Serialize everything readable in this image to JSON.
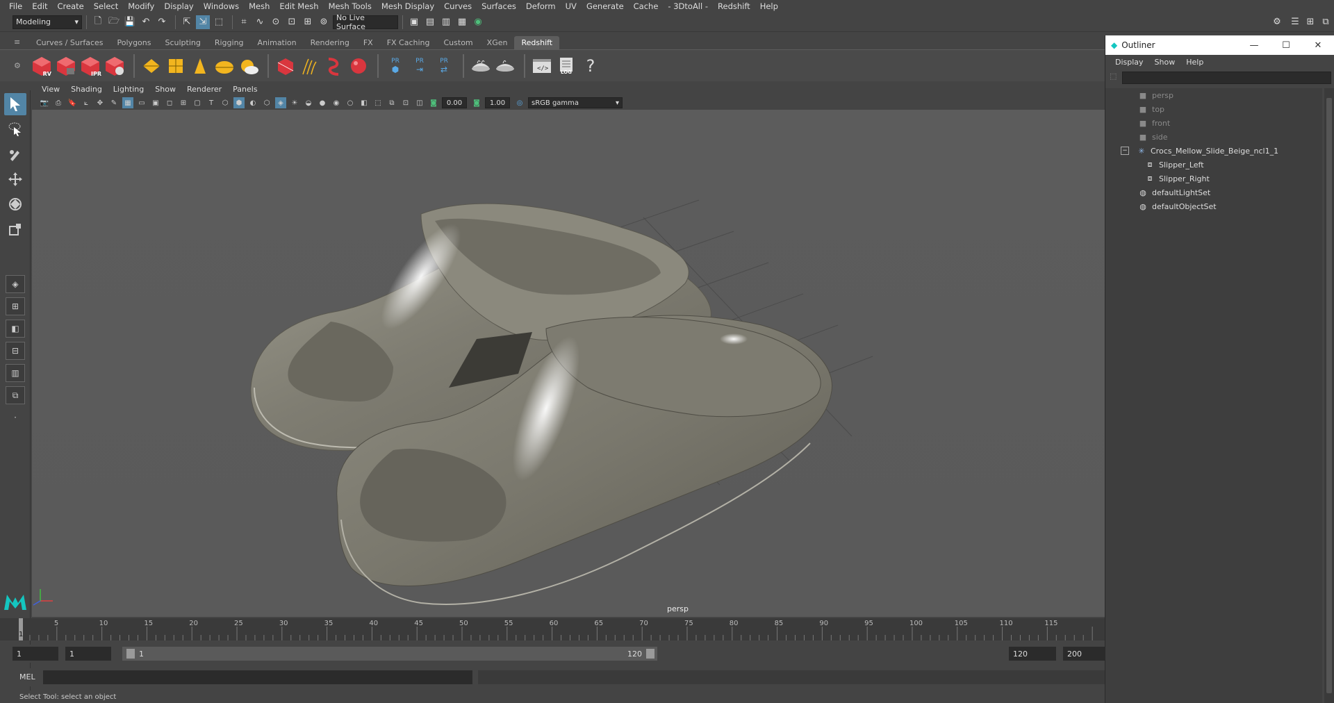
{
  "menubar": [
    "File",
    "Edit",
    "Create",
    "Select",
    "Modify",
    "Display",
    "Windows",
    "Mesh",
    "Edit Mesh",
    "Mesh Tools",
    "Mesh Display",
    "Curves",
    "Surfaces",
    "Deform",
    "UV",
    "Generate",
    "Cache",
    "- 3DtoAll -",
    "Redshift",
    "Help"
  ],
  "statusline": {
    "mode": "Modeling",
    "live_surface": "No Live Surface"
  },
  "shelf_tabs": [
    "Curves / Surfaces",
    "Polygons",
    "Sculpting",
    "Rigging",
    "Animation",
    "Rendering",
    "FX",
    "FX Caching",
    "Custom",
    "XGen",
    "Redshift"
  ],
  "active_shelf": "Redshift",
  "shelf_labels": {
    "rv": "RV",
    "ipr": "IPR",
    "pr": "PR",
    "log": "LOG"
  },
  "panel_menu": [
    "View",
    "Shading",
    "Lighting",
    "Show",
    "Renderer",
    "Panels"
  ],
  "view_toolbar": {
    "exposure": "0.00",
    "gamma": "1.00",
    "color_space": "sRGB gamma"
  },
  "viewport": {
    "camera_label": "persp"
  },
  "outliner": {
    "title": "Outliner",
    "menu": [
      "Display",
      "Show",
      "Help"
    ],
    "items": [
      {
        "label": "persp",
        "dim": true
      },
      {
        "label": "top",
        "dim": true
      },
      {
        "label": "front",
        "dim": true
      },
      {
        "label": "side",
        "dim": true
      },
      {
        "label": "Crocs_Mellow_Slide_Beige_ncl1_1",
        "dim": false
      },
      {
        "label": "Slipper_Left",
        "dim": false
      },
      {
        "label": "Slipper_Right",
        "dim": false
      },
      {
        "label": "defaultLightSet",
        "dim": false
      },
      {
        "label": "defaultObjectSet",
        "dim": false
      }
    ]
  },
  "timeline": {
    "ticks": [
      "5",
      "10",
      "15",
      "20",
      "25",
      "30",
      "35",
      "40",
      "45",
      "50",
      "55",
      "60",
      "65",
      "70",
      "75",
      "80",
      "85",
      "90",
      "95",
      "100",
      "105",
      "110",
      "115"
    ],
    "current_frame": "1"
  },
  "range": {
    "start": "1",
    "playback_start": "1",
    "slider_start": "1",
    "slider_end": "120",
    "playback_end": "120",
    "end": "200"
  },
  "cmdline": {
    "label": "MEL"
  },
  "helpline": "Select Tool: select an object",
  "colors": {
    "accent": "#5285a6",
    "redshift": "#d9363e",
    "yellow": "#f2b51f",
    "slipper": "#8a887c"
  }
}
